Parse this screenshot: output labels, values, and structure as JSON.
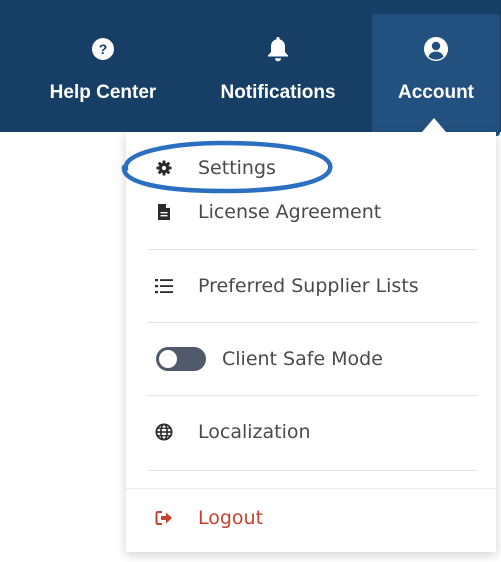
{
  "nav": {
    "help_label": "Help Center",
    "notifications_label": "Notifications",
    "account_label": "Account"
  },
  "menu": {
    "settings": "Settings",
    "license": "License Agreement",
    "suppliers": "Preferred Supplier Lists",
    "client_safe": "Client Safe Mode",
    "client_safe_on": false,
    "localization": "Localization",
    "logout": "Logout"
  },
  "colors": {
    "navbar": "#173f66",
    "account_active": "#22507f",
    "logout": "#c4432f",
    "annotation": "#2a6fc0"
  }
}
